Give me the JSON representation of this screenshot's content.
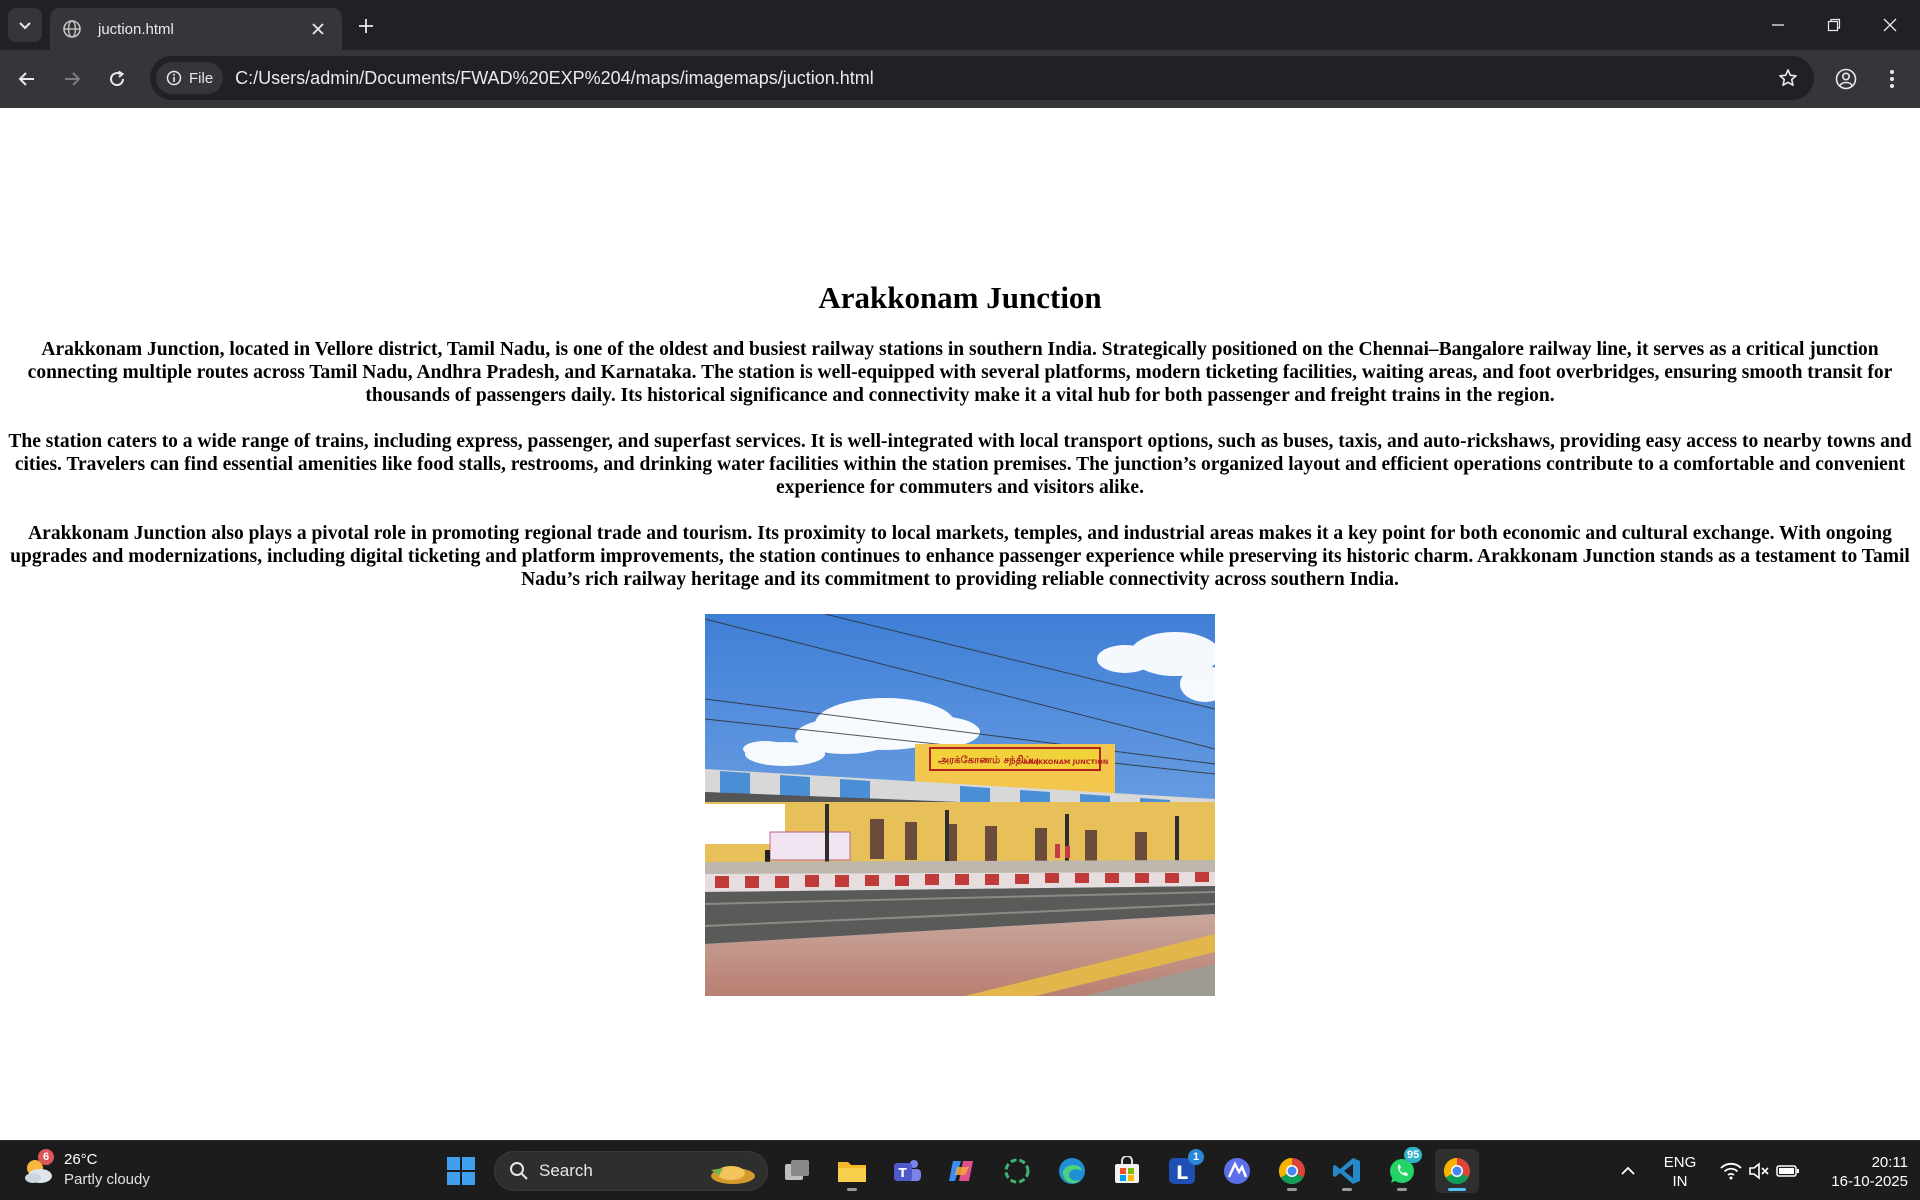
{
  "browser": {
    "tab_title": "juction.html",
    "chip_label": "File",
    "url": "C:/Users/admin/Documents/FWAD%20EXP%204/maps/imagemaps/juction.html"
  },
  "page": {
    "heading": "Arakkonam Junction",
    "paragraphs": [
      "Arakkonam Junction, located in Vellore district, Tamil Nadu, is one of the oldest and busiest railway stations in southern India. Strategically positioned on the Chennai–Bangalore railway line, it serves as a critical junction connecting multiple routes across Tamil Nadu, Andhra Pradesh, and Karnataka. The station is well-equipped with several platforms, modern ticketing facilities, waiting areas, and foot overbridges, ensuring smooth transit for thousands of passengers daily. Its historical significance and connectivity make it a vital hub for both passenger and freight trains in the region.",
      "The station caters to a wide range of trains, including express, passenger, and superfast services. It is well-integrated with local transport options, such as buses, taxis, and auto-rickshaws, providing easy access to nearby towns and cities. Travelers can find essential amenities like food stalls, restrooms, and drinking water facilities within the station premises. The junction’s organized layout and efficient operations contribute to a comfortable and convenient experience for commuters and visitors alike.",
      "Arakkonam Junction also plays a pivotal role in promoting regional trade and tourism. Its proximity to local markets, temples, and industrial areas makes it a key point for both economic and cultural exchange. With ongoing upgrades and modernizations, including digital ticketing and platform improvements, the station continues to enhance passenger experience while preserving its historic charm. Arakkonam Junction stands as a testament to Tamil Nadu’s rich railway heritage and its commitment to providing reliable connectivity across southern India."
    ],
    "photo_sign": {
      "tamil": "அரக்கோணம் சந்திப்பு",
      "english": "ARAKKONAM JUNCTION"
    }
  },
  "taskbar": {
    "weather_temp": "26°C",
    "weather_cond": "Partly cloudy",
    "weather_badge": "6",
    "search_label": "Search",
    "teams_badge": "1",
    "whatsapp_badge": "95",
    "lang_top": "ENG",
    "lang_bottom": "IN",
    "time": "20:11",
    "date": "16-10-2025"
  },
  "colors": {
    "chrome_dark": "#202124",
    "chrome_toolbar": "#35363a",
    "taskbar": "#1c1c1c",
    "accent": "#4cc2ff"
  },
  "icons": [
    "tab-search-icon",
    "globe-icon",
    "close-icon",
    "new-tab-icon",
    "minimize-icon",
    "restore-icon",
    "window-close-icon",
    "back-icon",
    "forward-icon",
    "reload-icon",
    "info-icon",
    "star-icon",
    "profile-icon",
    "menu-icon",
    "windows-start-icon",
    "search-icon",
    "task-view-icon",
    "file-explorer-icon",
    "teams-icon",
    "copilot-icon",
    "sync-icon",
    "edge-icon",
    "store-icon",
    "app-l-icon",
    "app-delta-icon",
    "chrome-icon",
    "vscode-icon",
    "whatsapp-icon",
    "chevron-up-icon",
    "wifi-icon",
    "volume-muted-icon",
    "battery-icon"
  ]
}
